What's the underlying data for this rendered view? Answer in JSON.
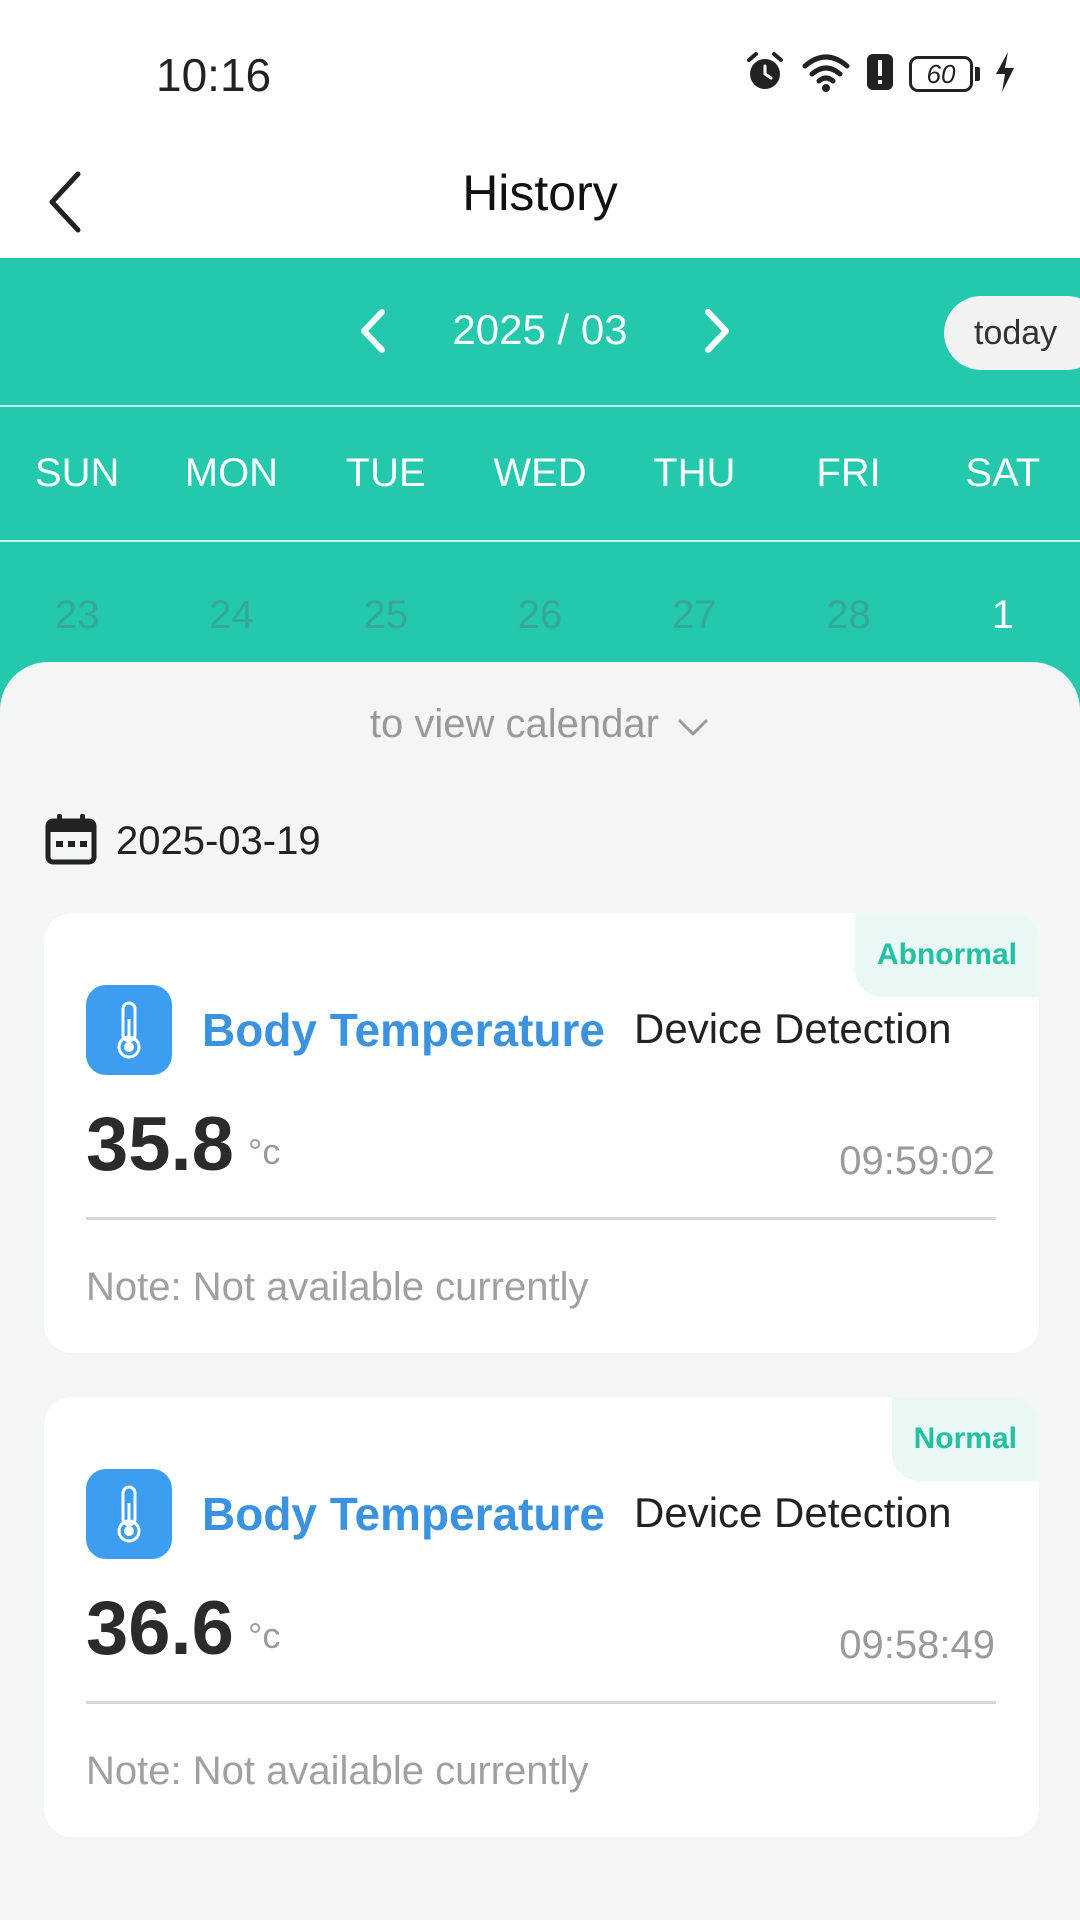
{
  "status_bar": {
    "time": "10:16",
    "battery_level": "60",
    "icons": [
      "alarm-icon",
      "wifi-icon",
      "alert-icon",
      "battery-icon",
      "charging-icon"
    ]
  },
  "header": {
    "title": "History",
    "back_icon": "chevron-left-icon"
  },
  "calendar": {
    "month_label": "2025 / 03",
    "today_label": "today",
    "weekdays": [
      "SUN",
      "MON",
      "TUE",
      "WED",
      "THU",
      "FRI",
      "SAT"
    ],
    "dates": [
      "23",
      "24",
      "25",
      "26",
      "27",
      "28",
      "1"
    ],
    "accent_color": "#23c8ad"
  },
  "content": {
    "view_calendar_label": "to view calendar",
    "date": "2025-03-19",
    "records": [
      {
        "status": "Abnormal",
        "title": "Body Temperature",
        "source": "Device Detection",
        "value": "35.8",
        "unit": "°c",
        "time": "09:59:02",
        "note": "Note: Not available currently"
      },
      {
        "status": "Normal",
        "title": "Body Temperature",
        "source": "Device Detection",
        "value": "36.6",
        "unit": "°c",
        "time": "09:58:49",
        "note": "Note: Not available currently"
      }
    ]
  }
}
